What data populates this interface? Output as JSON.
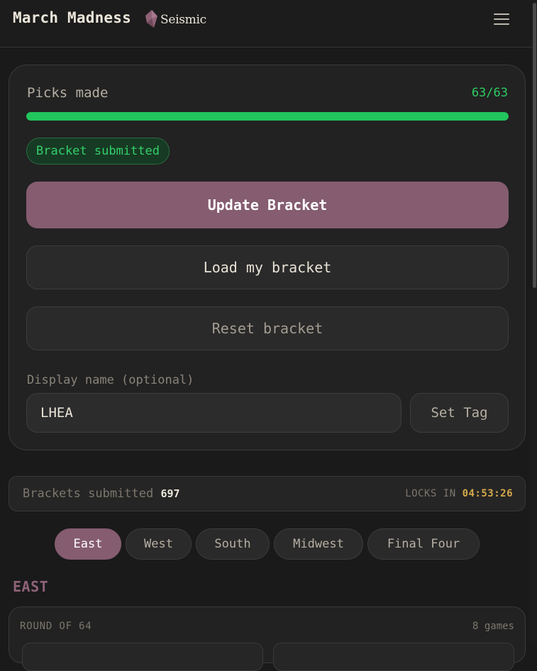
{
  "header": {
    "title": "March Madness",
    "brand": "Seismic",
    "menu_icon": "hamburger-menu-icon"
  },
  "picks": {
    "label": "Picks made",
    "count": "63/63",
    "progress": 1.0,
    "status": "Bracket submitted",
    "color_accent": "#22c55e"
  },
  "actions": {
    "update": "Update Bracket",
    "load": "Load my bracket",
    "reset": "Reset bracket"
  },
  "display_name": {
    "label": "Display name (optional)",
    "value": "LHEA",
    "set_tag": "Set Tag"
  },
  "stats": {
    "label": "Brackets submitted",
    "count": "697",
    "locks_label": "LOCKS IN",
    "locks_time": "04:53:26"
  },
  "tabs": [
    {
      "label": "East",
      "active": true
    },
    {
      "label": "West",
      "active": false
    },
    {
      "label": "South",
      "active": false
    },
    {
      "label": "Midwest",
      "active": false
    },
    {
      "label": "Final Four",
      "active": false
    }
  ],
  "region": {
    "title": "EAST",
    "round_label": "ROUND OF 64",
    "round_games": "8 games"
  },
  "colors": {
    "background": "#1a1a1a",
    "primary": "#855c70",
    "success": "#22c55e",
    "timer": "#d6a94a"
  }
}
